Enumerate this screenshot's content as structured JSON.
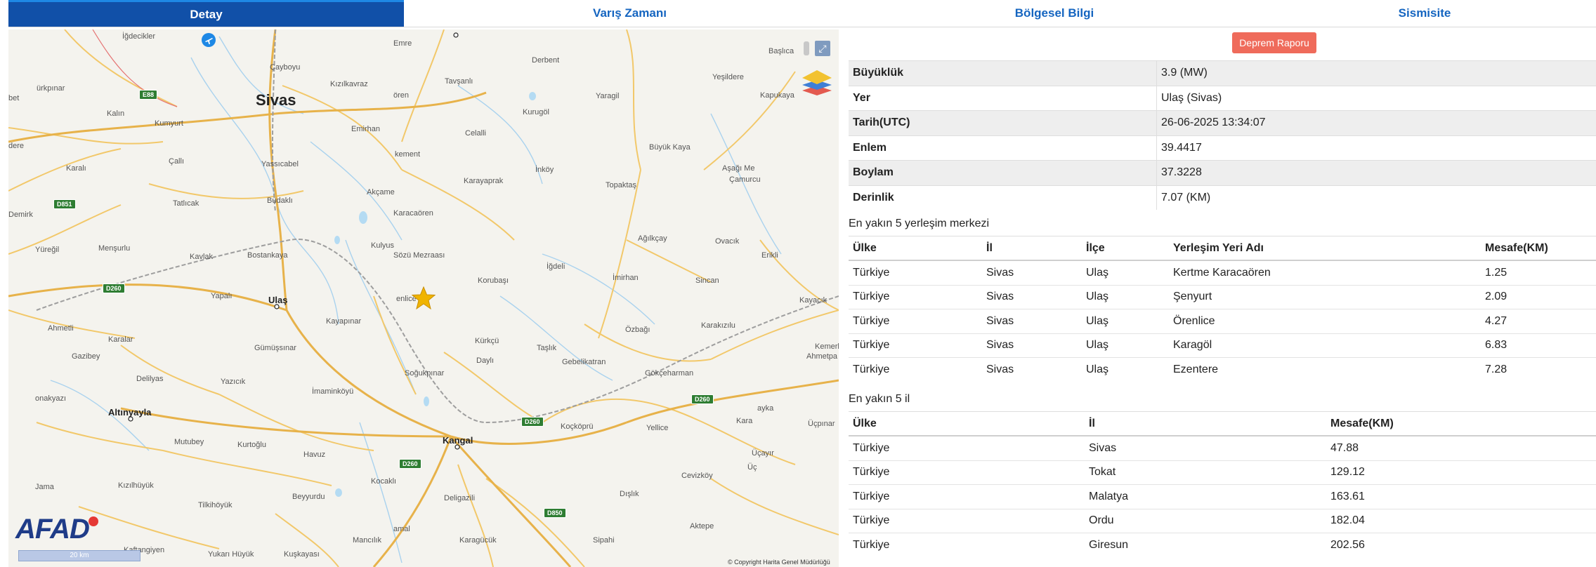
{
  "tabs": [
    {
      "label": "Detay",
      "active": true
    },
    {
      "label": "Varış Zamanı",
      "active": false
    },
    {
      "label": "Bölgesel Bilgi",
      "active": false
    },
    {
      "label": "Sismisite",
      "active": false
    }
  ],
  "map": {
    "places": {
      "sivas": "Sivas",
      "ulas": "Ulaş",
      "kangal": "Kangal",
      "altinyayla": "Altınyayla",
      "igdecikler": "İğdecikler",
      "emre": "Emre",
      "derbent": "Derbent",
      "basica": "Başlıca",
      "caybiyu": "Çayboyu",
      "tavsanli": "Tavşanlı",
      "yesildere": "Yeşildere",
      "kizilkavraz": "Kızılkavraz",
      "oren": "ören",
      "kurugol": "Kurugöl",
      "yaragil": "Yaragil",
      "kapukaya": "Kapukaya",
      "urkpinar": "ürkpınar",
      "bet": "bet",
      "kalin": "Kalın",
      "kumyurt": "Kumyurt",
      "emirhan": "Emirhan",
      "celalli": "Celalli",
      "buyukkaya": "Büyük Kaya",
      "dere": "dere",
      "karali": "Karalı",
      "calli": "Çallı",
      "yassicabel": "Yassıcabel",
      "kement": "kement",
      "inkoy": "İnköy",
      "asagime": "Aşağı Me",
      "camurcu": "Çamurcu",
      "topaktas": "Topaktaş",
      "karayaprak": "Karayaprak",
      "akcame": "Akçame",
      "tatlicak": "Tatlıcak",
      "budakli": "Budaklı",
      "demirk": "Demirk",
      "karacaoren": "Karacaören",
      "agilkcay": "Ağılkçay",
      "ovacik": "Ovacık",
      "yuregil": "Yüreğil",
      "mensurlu": "Menşurlu",
      "kulyus": "Kulyus",
      "sozumezra": "Sözü Mezraası",
      "kavlak": "Kavlak",
      "bostankaya": "Bostankaya",
      "erikli": "Erikli",
      "igdeli": "İğdeli",
      "imirhan": "İmirhan",
      "korubasi": "Korubaşı",
      "sincan": "Sincan",
      "kayacik": "Kayacık",
      "yapali": "Yapalı",
      "enlice": "enlice",
      "kayapinar": "Kayapınar",
      "ozbagi": "Özbağı",
      "karakizulu": "Karakızılu",
      "ahmetli": "Ahmetli",
      "karalar": "Karalar",
      "gumussinar": "Gümüşsınar",
      "kurkcu": "Kürkçü",
      "taslik": "Taşlık",
      "kemerl": "Kemerl",
      "ahmetpa": "Ahmetpa",
      "gazibey": "Gazibey",
      "dayli": "Daylı",
      "gebelikatran": "Gebelikatran",
      "delilyas": "Delilyas",
      "yazicik": "Yazıcık",
      "sogukpinar": "Soğukpınar",
      "gokceharman": "Gökçeharman",
      "imaminkoyu": "İmaminköyü",
      "onakyazi": "onakyazı",
      "ayka": "ayka",
      "kara": "Kara",
      "ucpinar": "Üçpınar",
      "kokcopru": "Koçköprü",
      "yellice": "Yellice",
      "mutubey": "Mutubey",
      "kurtoglu": "Kurtoğlu",
      "havuz": "Havuz",
      "ucayir": "Üçayır",
      "uc": "Üç",
      "kizilhuyuk": "Kızılhüyük",
      "jama": "Jama",
      "kocakli": "Kocaklı",
      "cevizkoy": "Cevizköy",
      "tilkihoyuk": "Tilkihöyük",
      "beyyurdu": "Beyyurdu",
      "deligazili": "Deligazili",
      "dislik": "Dışlık",
      "aktepe": "Aktepe",
      "amal": "amal",
      "karagucuk": "Karagücük",
      "manculik": "Mancılık",
      "sipahi": "Sipahi",
      "kaftangiyen": "Kaftangiyen",
      "yukanhuyuk": "Yukarı Hüyük",
      "kuskayasi": "Kuşkayası"
    },
    "shields": {
      "e88": "E88",
      "d851": "D851",
      "d260a": "D260",
      "d260b": "D260",
      "d260c": "D260",
      "d260d": "D260",
      "d850": "D850"
    },
    "logo": "AFAD",
    "scale": "20 km",
    "copyright": "© Copyright Harita Genel Müdürlüğü"
  },
  "panel": {
    "report_button": "Deprem Raporu",
    "details": [
      {
        "key": "Büyüklük",
        "value": "3.9 (MW)"
      },
      {
        "key": "Yer",
        "value": "Ulaş (Sivas)"
      },
      {
        "key": "Tarih(UTC)",
        "value": "26-06-2025 13:34:07"
      },
      {
        "key": "Enlem",
        "value": "39.4417"
      },
      {
        "key": "Boylam",
        "value": "37.3228"
      },
      {
        "key": "Derinlik",
        "value": "7.07 (KM)"
      }
    ],
    "settlements_title": "En yakın 5 yerleşim merkezi",
    "settlements_headers": [
      "Ülke",
      "İl",
      "İlçe",
      "Yerleşim Yeri Adı",
      "Mesafe(KM)"
    ],
    "settlements": [
      [
        "Türkiye",
        "Sivas",
        "Ulaş",
        "Kertme Karacaören",
        "1.25"
      ],
      [
        "Türkiye",
        "Sivas",
        "Ulaş",
        "Şenyurt",
        "2.09"
      ],
      [
        "Türkiye",
        "Sivas",
        "Ulaş",
        "Örenlice",
        "4.27"
      ],
      [
        "Türkiye",
        "Sivas",
        "Ulaş",
        "Karagöl",
        "6.83"
      ],
      [
        "Türkiye",
        "Sivas",
        "Ulaş",
        "Ezentere",
        "7.28"
      ]
    ],
    "provinces_title": "En yakın 5 il",
    "provinces_headers": [
      "Ülke",
      "İl",
      "Mesafe(KM)"
    ],
    "provinces": [
      [
        "Türkiye",
        "Sivas",
        "47.88"
      ],
      [
        "Türkiye",
        "Tokat",
        "129.12"
      ],
      [
        "Türkiye",
        "Malatya",
        "163.61"
      ],
      [
        "Türkiye",
        "Ordu",
        "182.04"
      ],
      [
        "Türkiye",
        "Giresun",
        "202.56"
      ]
    ]
  }
}
